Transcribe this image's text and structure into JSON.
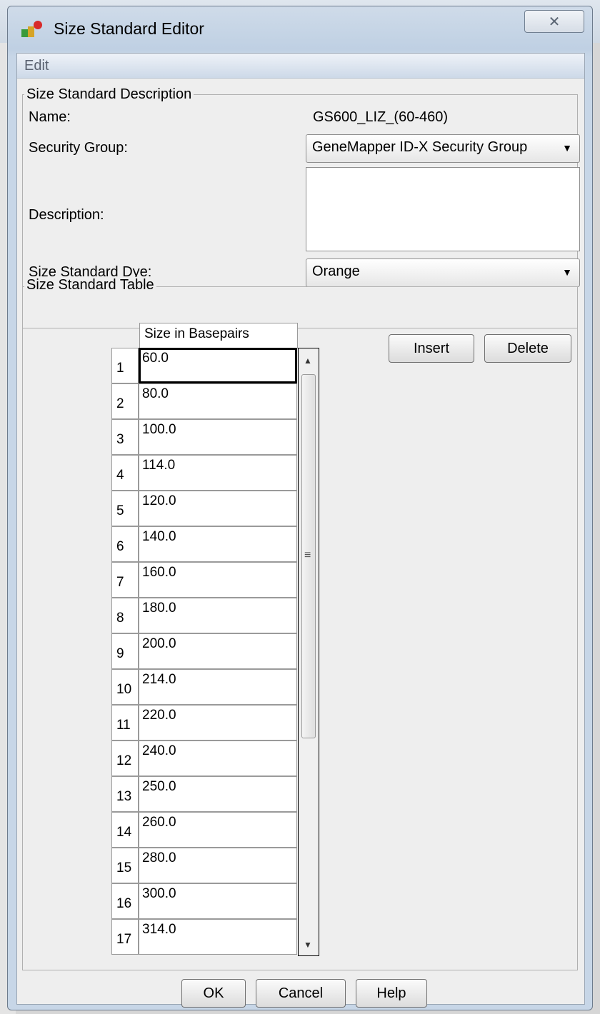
{
  "window": {
    "title": "Size Standard Editor"
  },
  "menu": {
    "edit": "Edit"
  },
  "description_section": {
    "legend": "Size Standard Description",
    "name_label": "Name:",
    "name_value": "GS600_LIZ_(60-460)",
    "security_label": "Security Group:",
    "security_value": "GeneMapper ID-X Security Group",
    "description_label": "Description:",
    "description_value": "",
    "dye_label": "Size Standard Dye:",
    "dye_value": "Orange"
  },
  "table_section": {
    "legend": "Size Standard Table",
    "column_header": "Size in Basepairs",
    "insert_label": "Insert",
    "delete_label": "Delete",
    "rows": [
      {
        "num": "1",
        "size": "60.0"
      },
      {
        "num": "2",
        "size": "80.0"
      },
      {
        "num": "3",
        "size": "100.0"
      },
      {
        "num": "4",
        "size": "114.0"
      },
      {
        "num": "5",
        "size": "120.0"
      },
      {
        "num": "6",
        "size": "140.0"
      },
      {
        "num": "7",
        "size": "160.0"
      },
      {
        "num": "8",
        "size": "180.0"
      },
      {
        "num": "9",
        "size": "200.0"
      },
      {
        "num": "10",
        "size": "214.0"
      },
      {
        "num": "11",
        "size": "220.0"
      },
      {
        "num": "12",
        "size": "240.0"
      },
      {
        "num": "13",
        "size": "250.0"
      },
      {
        "num": "14",
        "size": "260.0"
      },
      {
        "num": "15",
        "size": "280.0"
      },
      {
        "num": "16",
        "size": "300.0"
      },
      {
        "num": "17",
        "size": "314.0"
      }
    ]
  },
  "footer": {
    "ok_label": "OK",
    "cancel_label": "Cancel",
    "help_label": "Help"
  },
  "icons": {
    "close": "close-icon",
    "app": "app-icon",
    "dropdown": "chevron-down-icon"
  }
}
